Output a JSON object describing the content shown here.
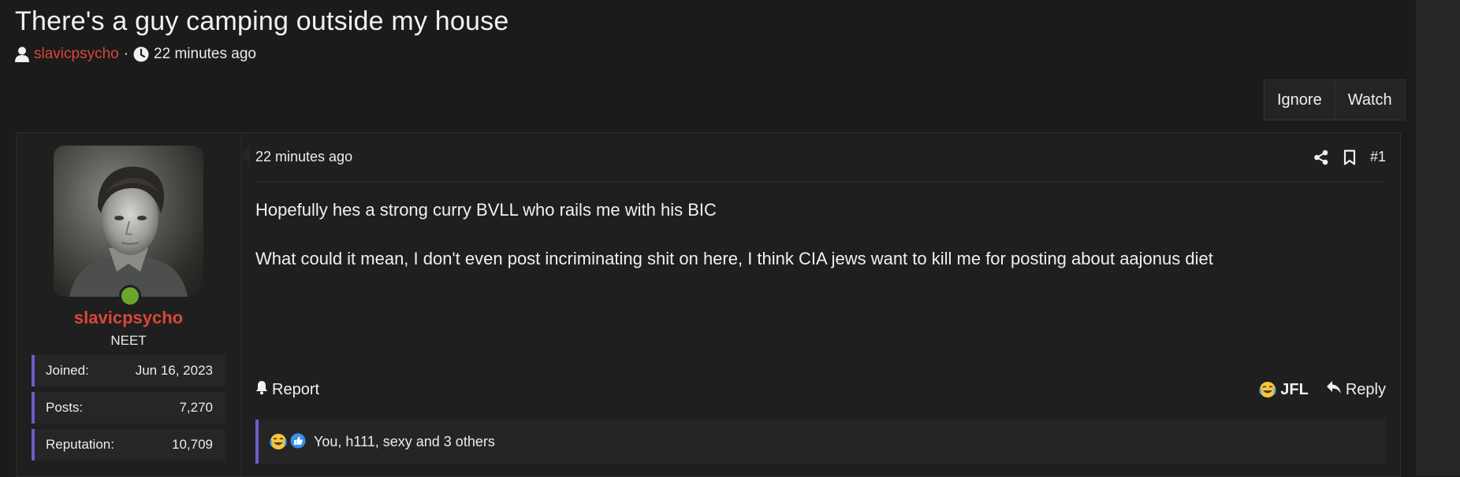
{
  "thread": {
    "title": "There's a guy camping outside my house",
    "author": "slavicpsycho",
    "separator": "·",
    "time": "22 minutes ago",
    "ignore_label": "Ignore",
    "watch_label": "Watch"
  },
  "post": {
    "user": {
      "name": "slavicpsycho",
      "title": "NEET",
      "online": true,
      "stats": [
        {
          "label": "Joined:",
          "value": "Jun 16, 2023"
        },
        {
          "label": "Posts:",
          "value": "7,270"
        },
        {
          "label": "Reputation:",
          "value": "10,709"
        }
      ]
    },
    "date": "22 minutes ago",
    "number": "#1",
    "body": [
      "Hopefully hes a strong curry BVLL who rails me with his BIC",
      "What could it mean, I don't even post incriminating shit on here, I think CIA jews want to kill me for posting about aajonus diet"
    ],
    "report_label": "Report",
    "react_label": "JFL",
    "reply_label": "Reply",
    "reactions_text": "You, h111, sexy and 3 others"
  },
  "colors": {
    "accent_red": "#d9463a",
    "accent_purple": "#6a5fc9",
    "online_green": "#6aa52e"
  },
  "icons": [
    "user-icon",
    "clock-icon",
    "share-icon",
    "bookmark-icon",
    "bell-icon",
    "laughing-crying-emoji-icon",
    "reply-icon",
    "thumbs-up-icon"
  ]
}
